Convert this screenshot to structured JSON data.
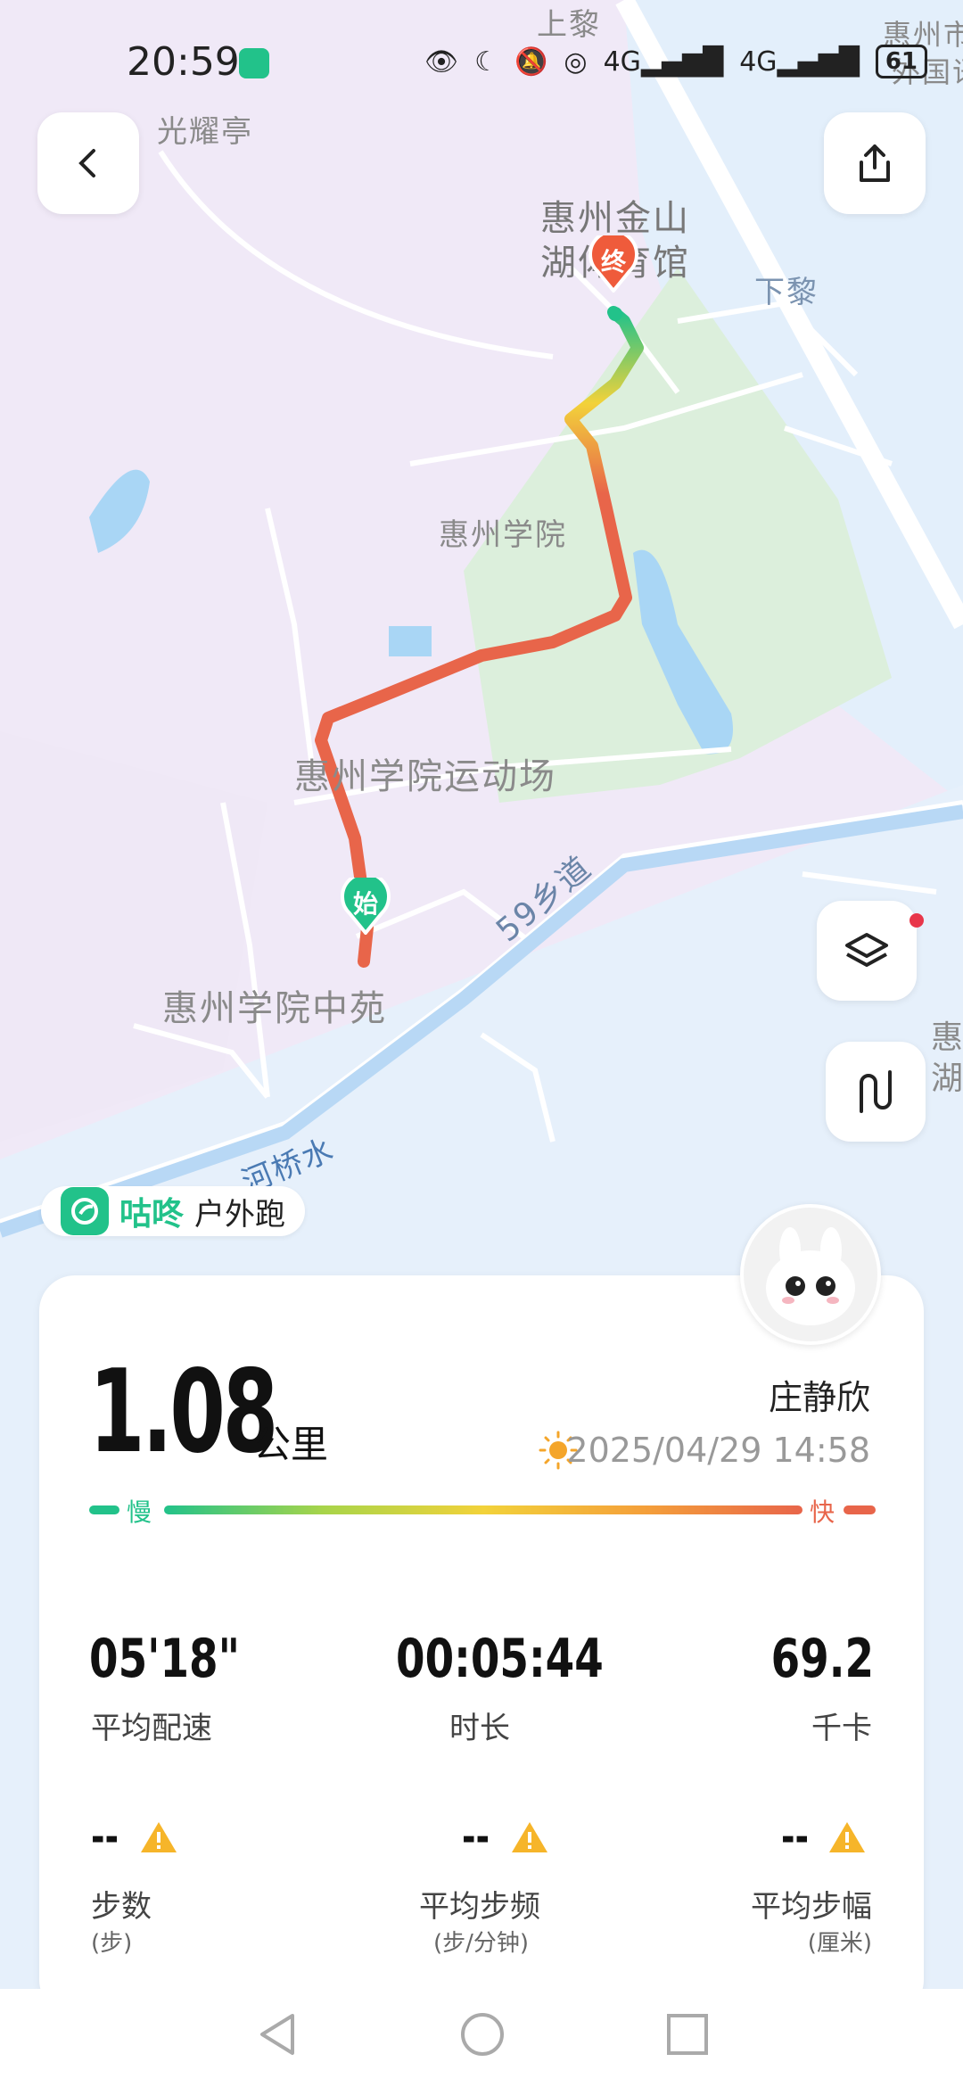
{
  "status_bar": {
    "time": "20:59",
    "battery": "61"
  },
  "map_labels": {
    "shangli": "上黎",
    "huizhou_city": "惠州市",
    "waiguo": "外国语",
    "guangyaoting": "光耀亭",
    "gym_line1": "惠州金山",
    "gym_line2": "湖体育馆",
    "xiali": "下黎",
    "university": "惠州学院",
    "stadium": "惠州学院运动场",
    "zhongyuan": "惠州学院中苑",
    "road59": "59乡道",
    "hebei": "河桥水",
    "huzhou_edge1": "惠",
    "huzhou_edge2": "湖"
  },
  "markers": {
    "start": "始",
    "end": "终"
  },
  "activity_badge": {
    "brand": "咕咚",
    "type": "户外跑"
  },
  "summary": {
    "distance": "1.08",
    "distance_unit": "公里",
    "user_name": "庄静欣",
    "datetime": "2025/04/29 14:58",
    "slow_label": "慢",
    "fast_label": "快"
  },
  "stats": [
    {
      "value": "05'18\"",
      "label": "平均配速"
    },
    {
      "value": "00:05:44",
      "label": "时长"
    },
    {
      "value": "69.2",
      "label": "千卡"
    }
  ],
  "stats2": [
    {
      "value": "--",
      "label": "步数",
      "sub": "(步)"
    },
    {
      "value": "--",
      "label": "平均步频",
      "sub": "(步/分钟)"
    },
    {
      "value": "--",
      "label": "平均步幅",
      "sub": "(厘米)"
    }
  ],
  "colors": {
    "accent": "#22c28a",
    "route_fast": "#e8654a",
    "route_mid": "#f2d23a",
    "warning": "#f6b52a"
  },
  "icons": {
    "back": "chevron-left-icon",
    "share": "share-icon",
    "layers": "layers-icon",
    "route": "route-icon",
    "weather": "sun-icon",
    "warning": "warning-icon"
  }
}
